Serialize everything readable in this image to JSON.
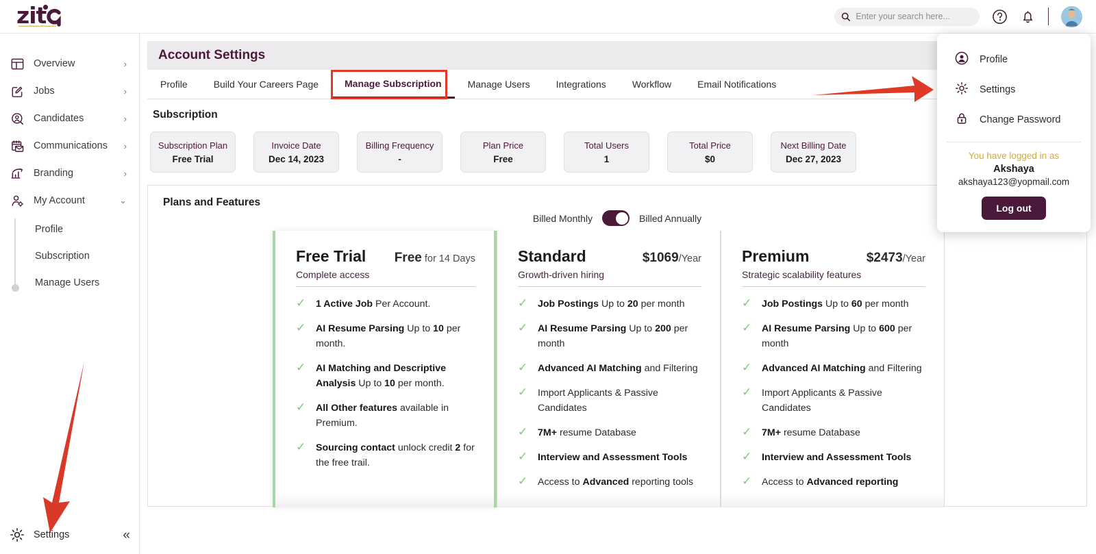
{
  "brand": {
    "name": "zita",
    "primary_color": "#4b1a3a",
    "accent_green": "#7ec97a",
    "annotation_red": "#e03a26",
    "gold": "#d8a93b"
  },
  "topbar": {
    "search": {
      "placeholder": "Enter your search here...",
      "value": "",
      "icon": "search-icon"
    },
    "help_icon": "help-circle-icon",
    "notification_icon": "bell-icon",
    "avatar_icon": "user-avatar"
  },
  "sidebar": {
    "items": [
      {
        "label": "Overview",
        "icon": "layout-dashboard-icon",
        "chevron": "›",
        "expanded": false
      },
      {
        "label": "Jobs",
        "icon": "edit-square-icon",
        "chevron": "›",
        "expanded": false
      },
      {
        "label": "Candidates",
        "icon": "user-search-icon",
        "chevron": "›",
        "expanded": false
      },
      {
        "label": "Communications",
        "icon": "mail-calendar-icon",
        "chevron": "›",
        "expanded": false
      },
      {
        "label": "Branding",
        "icon": "bar-chart-up-icon",
        "chevron": "›",
        "expanded": false
      },
      {
        "label": "My Account",
        "icon": "user-gear-icon",
        "chevron": "⌄",
        "expanded": true
      }
    ],
    "submenu": [
      {
        "label": "Profile"
      },
      {
        "label": "Subscription"
      },
      {
        "label": "Manage Users"
      }
    ],
    "bottom": {
      "label": "Settings",
      "icon": "gear-icon",
      "collapse_icon": "«"
    }
  },
  "page": {
    "title": "Account Settings",
    "tabs": [
      {
        "label": "Profile",
        "active": false
      },
      {
        "label": "Build Your Careers Page",
        "active": false
      },
      {
        "label": "Manage Subscription",
        "active": true
      },
      {
        "label": "Manage Users",
        "active": false
      },
      {
        "label": "Integrations",
        "active": false
      },
      {
        "label": "Workflow",
        "active": false
      },
      {
        "label": "Email Notifications",
        "active": false
      }
    ]
  },
  "subscription": {
    "section_title": "Subscription",
    "stats": [
      {
        "label": "Subscription Plan",
        "value": "Free Trial"
      },
      {
        "label": "Invoice Date",
        "value": "Dec 14, 2023"
      },
      {
        "label": "Billing Frequency",
        "value": "-"
      },
      {
        "label": "Plan Price",
        "value": "Free"
      },
      {
        "label": "Total Users",
        "value": "1"
      },
      {
        "label": "Total Price",
        "value": "$0"
      },
      {
        "label": "Next Billing Date",
        "value": "Dec 27, 2023"
      }
    ]
  },
  "plans": {
    "section_title": "Plans and Features",
    "toggle": {
      "left_label": "Billed Monthly",
      "right_label": "Billed Annually",
      "selected": "Billed Annually"
    },
    "cards": [
      {
        "name": "Free Trial",
        "price_bold": "Free",
        "price_rest": " for 14 Days",
        "subtitle": "Complete access",
        "highlighted": true,
        "features": [
          {
            "bold": "1 Active Job",
            "rest": " Per Account."
          },
          {
            "bold": "AI Resume Parsing",
            "rest": " Up to ",
            "bold2": "10",
            "rest2": " per month."
          },
          {
            "bold": "AI Matching and Descriptive Analysis",
            "rest": " Up to ",
            "bold2": "10",
            "rest2": " per month."
          },
          {
            "bold": "All Other features",
            "rest": " available in Premium."
          },
          {
            "bold": "Sourcing contact",
            "rest": " unlock credit ",
            "bold2": "2",
            "rest2": " for the free trail."
          }
        ]
      },
      {
        "name": "Standard",
        "price_bold": "$1069",
        "price_rest": "/Year",
        "subtitle": "Growth-driven hiring",
        "highlighted": false,
        "features": [
          {
            "bold": "Job Postings",
            "rest": " Up to ",
            "bold2": "20",
            "rest2": " per month"
          },
          {
            "bold": "AI Resume Parsing",
            "rest": " Up to ",
            "bold2": "200",
            "rest2": " per month"
          },
          {
            "bold": "Advanced AI Matching",
            "rest": " and Filtering"
          },
          {
            "bold": "",
            "rest": "Import Applicants & Passive Candidates"
          },
          {
            "bold": "7M+",
            "rest": " resume Database"
          },
          {
            "bold": "Interview and Assessment Tools",
            "rest": ""
          },
          {
            "bold": "",
            "rest": "Access to ",
            "bold2": "Advanced",
            "rest2": " reporting tools"
          }
        ]
      },
      {
        "name": "Premium",
        "price_bold": "$2473",
        "price_rest": "/Year",
        "subtitle": "Strategic scalability features",
        "highlighted": false,
        "features": [
          {
            "bold": "Job Postings",
            "rest": " Up to ",
            "bold2": "60",
            "rest2": " per month"
          },
          {
            "bold": "AI Resume Parsing",
            "rest": " Up to ",
            "bold2": "600",
            "rest2": " per month"
          },
          {
            "bold": "Advanced AI Matching",
            "rest": " and Filtering"
          },
          {
            "bold": "",
            "rest": "Import Applicants & Passive Candidates"
          },
          {
            "bold": "7M+",
            "rest": " resume Database"
          },
          {
            "bold": "Interview and Assessment Tools",
            "rest": ""
          },
          {
            "bold": "",
            "rest": "Access to ",
            "bold2": "Advanced reporting",
            "rest2": ""
          }
        ]
      }
    ]
  },
  "profile_menu": {
    "items": [
      {
        "label": "Profile",
        "icon": "user-circle-icon"
      },
      {
        "label": "Settings",
        "icon": "gear-icon"
      },
      {
        "label": "Change Password",
        "icon": "lock-icon"
      }
    ],
    "logged_in_text": "You have logged in as",
    "user_name": "Akshaya",
    "user_email": "akshaya123@yopmail.com",
    "logout_label": "Log out"
  }
}
